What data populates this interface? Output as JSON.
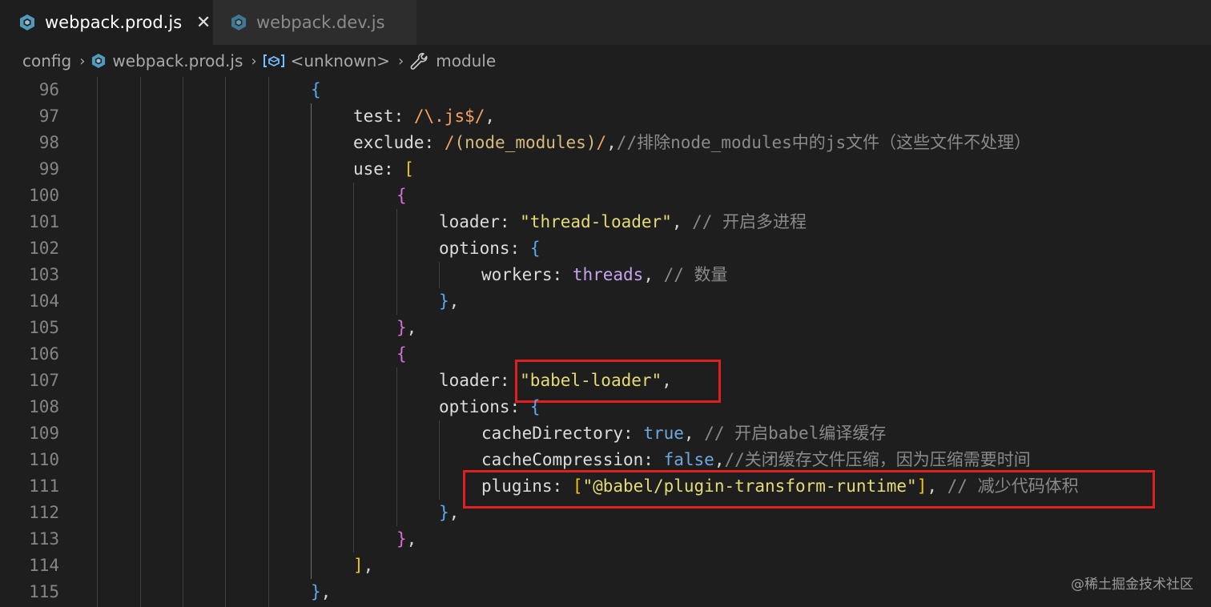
{
  "tabs": [
    {
      "label": "webpack.prod.js",
      "active": true,
      "close": "✕"
    },
    {
      "label": "webpack.dev.js",
      "active": false
    }
  ],
  "breadcrumb": {
    "folder": "config",
    "file": "webpack.prod.js",
    "symbol": "<unknown>",
    "property": "module"
  },
  "editor": {
    "lines": [
      {
        "n": "96",
        "indent": 0,
        "parts": [
          [
            "{",
            "b-blue"
          ]
        ]
      },
      {
        "n": "97",
        "indent": 1,
        "parts": [
          [
            "test",
            "c-key"
          ],
          [
            ": ",
            "c-plain"
          ],
          [
            "/\\.js$/",
            "c-regex"
          ],
          [
            ",",
            "c-plain"
          ]
        ]
      },
      {
        "n": "98",
        "indent": 1,
        "parts": [
          [
            "exclude",
            "c-key"
          ],
          [
            ": ",
            "c-plain"
          ],
          [
            "/",
            "c-regex"
          ],
          [
            "(node_modules)",
            "c-regex2"
          ],
          [
            "/",
            "c-regex"
          ],
          [
            ",",
            "c-plain"
          ],
          [
            "//排除node_modules中的js文件（这些文件不处理）",
            "c-comment"
          ]
        ]
      },
      {
        "n": "99",
        "indent": 1,
        "parts": [
          [
            "use",
            "c-key"
          ],
          [
            ": ",
            "c-plain"
          ],
          [
            "[",
            "b-yellow"
          ]
        ]
      },
      {
        "n": "100",
        "indent": 2,
        "parts": [
          [
            "{",
            "b-pink"
          ]
        ]
      },
      {
        "n": "101",
        "indent": 3,
        "parts": [
          [
            "loader",
            "c-key"
          ],
          [
            ": ",
            "c-plain"
          ],
          [
            "\"thread-loader\"",
            "c-str"
          ],
          [
            ", ",
            "c-plain"
          ],
          [
            "// 开启多进程",
            "c-comment"
          ]
        ]
      },
      {
        "n": "102",
        "indent": 3,
        "parts": [
          [
            "options",
            "c-key"
          ],
          [
            ": ",
            "c-plain"
          ],
          [
            "{",
            "b-blue"
          ]
        ]
      },
      {
        "n": "103",
        "indent": 4,
        "parts": [
          [
            "workers",
            "c-key"
          ],
          [
            ": ",
            "c-plain"
          ],
          [
            "threads",
            "c-var"
          ],
          [
            ", ",
            "c-plain"
          ],
          [
            "// 数量",
            "c-comment"
          ]
        ]
      },
      {
        "n": "104",
        "indent": 3,
        "parts": [
          [
            "}",
            "b-blue"
          ],
          [
            ",",
            "c-plain"
          ]
        ]
      },
      {
        "n": "105",
        "indent": 2,
        "parts": [
          [
            "}",
            "b-pink"
          ],
          [
            ",",
            "c-plain"
          ]
        ]
      },
      {
        "n": "106",
        "indent": 2,
        "parts": [
          [
            "{",
            "b-pink"
          ]
        ]
      },
      {
        "n": "107",
        "indent": 3,
        "parts": [
          [
            "loader",
            "c-key"
          ],
          [
            ": ",
            "c-plain"
          ],
          [
            "\"babel-loader\"",
            "c-str"
          ],
          [
            ",",
            "c-plain"
          ]
        ]
      },
      {
        "n": "108",
        "indent": 3,
        "parts": [
          [
            "options",
            "c-key"
          ],
          [
            ": ",
            "c-plain"
          ],
          [
            "{",
            "b-blue"
          ]
        ]
      },
      {
        "n": "109",
        "indent": 4,
        "parts": [
          [
            "cacheDirectory",
            "c-key"
          ],
          [
            ": ",
            "c-plain"
          ],
          [
            "true",
            "c-bool"
          ],
          [
            ", ",
            "c-plain"
          ],
          [
            "// 开启babel编译缓存",
            "c-comment"
          ]
        ]
      },
      {
        "n": "110",
        "indent": 4,
        "parts": [
          [
            "cacheCompression",
            "c-key"
          ],
          [
            ": ",
            "c-plain"
          ],
          [
            "false",
            "c-bool"
          ],
          [
            ",",
            "c-plain"
          ],
          [
            "//关闭缓存文件压缩，因为压缩需要时间",
            "c-comment"
          ]
        ]
      },
      {
        "n": "111",
        "indent": 4,
        "parts": [
          [
            "plugins",
            "c-key"
          ],
          [
            ": ",
            "c-plain"
          ],
          [
            "[",
            "b-yellow"
          ],
          [
            "\"@babel/plugin-transform-runtime\"",
            "c-str"
          ],
          [
            "]",
            "b-yellow"
          ],
          [
            ", ",
            "c-plain"
          ],
          [
            "// 减少代码体积",
            "c-comment"
          ]
        ]
      },
      {
        "n": "112",
        "indent": 3,
        "parts": [
          [
            "}",
            "b-blue"
          ],
          [
            ",",
            "c-plain"
          ]
        ]
      },
      {
        "n": "113",
        "indent": 2,
        "parts": [
          [
            "}",
            "b-pink"
          ],
          [
            ",",
            "c-plain"
          ]
        ]
      },
      {
        "n": "114",
        "indent": 1,
        "parts": [
          [
            "]",
            "b-yellow"
          ],
          [
            ",",
            "c-plain"
          ]
        ]
      },
      {
        "n": "115",
        "indent": 0,
        "parts": [
          [
            "}",
            "b-blue"
          ],
          [
            ",",
            "c-plain"
          ]
        ]
      }
    ]
  },
  "watermark": "@稀土掘金技术社区",
  "colors": {
    "highlight_box": "#e02020",
    "file_icon": "#519aba"
  }
}
